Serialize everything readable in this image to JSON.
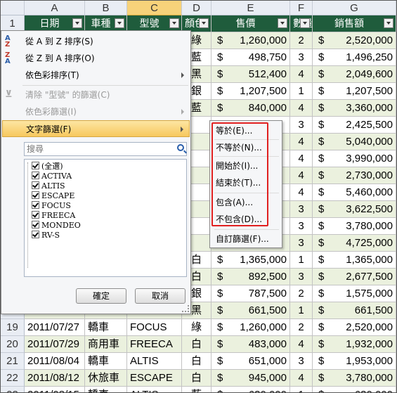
{
  "columns": {
    "corner": "",
    "letters": [
      "A",
      "B",
      "C",
      "D",
      "E",
      "F",
      "G"
    ],
    "selected": "C"
  },
  "row_numbers": [
    "1",
    "2",
    "3",
    "4",
    "5",
    "6",
    "7",
    "8",
    "9",
    "10",
    "11",
    "12",
    "13",
    "14",
    "15",
    "16",
    "17",
    "18",
    "19",
    "20",
    "21",
    "22",
    "23"
  ],
  "table_headers": {
    "date": "日期",
    "vehicle_type": "車種",
    "model": "型號",
    "color": "顏色",
    "price": "售價",
    "qty": "數量",
    "sales": "銷售額"
  },
  "currency": "$",
  "rows": [
    {
      "date": "",
      "type": "",
      "model": "",
      "color": "綠",
      "price": "1,260,000",
      "qty": "2",
      "sales": "2,520,000"
    },
    {
      "date": "",
      "type": "",
      "model": "",
      "color": "藍",
      "price": "498,750",
      "qty": "3",
      "sales": "1,496,250"
    },
    {
      "date": "",
      "type": "",
      "model": "",
      "color": "黑",
      "price": "512,400",
      "qty": "4",
      "sales": "2,049,600"
    },
    {
      "date": "",
      "type": "",
      "model": "",
      "color": "銀",
      "price": "1,207,500",
      "qty": "1",
      "sales": "1,207,500"
    },
    {
      "date": "",
      "type": "",
      "model": "",
      "color": "藍",
      "price": "840,000",
      "qty": "4",
      "sales": "3,360,000"
    },
    {
      "date": "",
      "type": "",
      "model": "",
      "color": "",
      "price": "",
      "qty": "3",
      "sales": "2,425,500"
    },
    {
      "date": "",
      "type": "",
      "model": "",
      "color": "",
      "price": "",
      "qty": "4",
      "sales": "5,040,000"
    },
    {
      "date": "",
      "type": "",
      "model": "",
      "color": "",
      "price": "",
      "qty": "4",
      "sales": "3,990,000"
    },
    {
      "date": "",
      "type": "",
      "model": "",
      "color": "",
      "price": "",
      "qty": "4",
      "sales": "2,730,000"
    },
    {
      "date": "",
      "type": "",
      "model": "",
      "color": "",
      "price": "",
      "qty": "4",
      "sales": "5,460,000"
    },
    {
      "date": "",
      "type": "",
      "model": "",
      "color": "",
      "price": "",
      "qty": "3",
      "sales": "3,622,500"
    },
    {
      "date": "",
      "type": "",
      "model": "",
      "color": "",
      "price": "",
      "qty": "3",
      "sales": "3,780,000"
    },
    {
      "date": "",
      "type": "",
      "model": "",
      "color": "",
      "price": "",
      "qty": "3",
      "sales": "4,725,000"
    },
    {
      "date": "",
      "type": "",
      "model": "",
      "color": "白",
      "price": "1,365,000",
      "qty": "1",
      "sales": "1,365,000"
    },
    {
      "date": "",
      "type": "",
      "model": "",
      "color": "白",
      "price": "892,500",
      "qty": "3",
      "sales": "2,677,500"
    },
    {
      "date": "",
      "type": "",
      "model": "",
      "color": "銀",
      "price": "787,500",
      "qty": "2",
      "sales": "1,575,000"
    },
    {
      "date": "",
      "type": "",
      "model": "",
      "color": "黑",
      "price": "661,500",
      "qty": "1",
      "sales": "661,500"
    },
    {
      "date": "2011/07/27",
      "type": "轎車",
      "model": "FOCUS",
      "color": "綠",
      "price": "1,260,000",
      "qty": "2",
      "sales": "2,520,000"
    },
    {
      "date": "2011/07/29",
      "type": "商用車",
      "model": "FREECA",
      "color": "白",
      "price": "483,000",
      "qty": "4",
      "sales": "1,932,000"
    },
    {
      "date": "2011/08/04",
      "type": "轎車",
      "model": "ALTIS",
      "color": "白",
      "price": "651,000",
      "qty": "3",
      "sales": "1,953,000"
    },
    {
      "date": "2011/08/12",
      "type": "休旅車",
      "model": "ESCAPE",
      "color": "白",
      "price": "945,000",
      "qty": "4",
      "sales": "3,780,000"
    },
    {
      "date": "2011/08/15",
      "type": "轎車",
      "model": "ALTIS",
      "color": "藍",
      "price": "630,000",
      "qty": "1",
      "sales": "630,000"
    }
  ],
  "filter_menu": {
    "sort_az": "從 A 到 Z 排序(S)",
    "sort_za": "從 Z 到 A 排序(O)",
    "sort_color": "依色彩排序(T)",
    "clear_filter": "清除 \"型號\" 的篩選(C)",
    "filter_color": "依色彩篩選(I)",
    "text_filter": "文字篩選(F)",
    "search_placeholder": "搜尋",
    "items": [
      "(全選)",
      "ACTIVA",
      "ALTIS",
      "ESCAPE",
      "FOCUS",
      "FREECA",
      "MONDEO",
      "RV-S"
    ],
    "ok": "確定",
    "cancel": "取消"
  },
  "text_filter_submenu": {
    "equals": "等於(E)...",
    "not_equals": "不等於(N)...",
    "begins_with": "開始於(I)...",
    "ends_with": "結束於(T)...",
    "contains": "包含(A)...",
    "not_contains": "不包含(D)...",
    "custom": "自訂篩選(F)..."
  },
  "colors": {
    "header_green": "#1f5c3c",
    "row_alt": "#ebf1de",
    "selected_col": "#f7d27a",
    "highlight_box": "#e02020"
  }
}
